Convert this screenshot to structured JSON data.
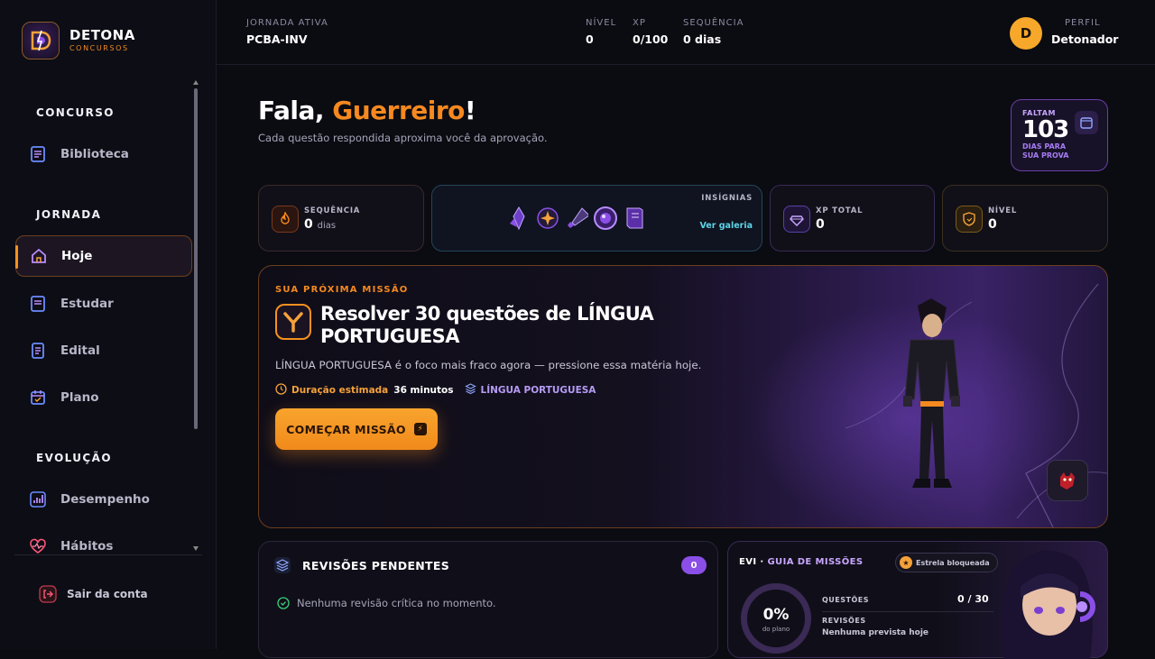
{
  "brand": {
    "name": "DETONA",
    "sub": "CONCURSOS"
  },
  "sidebar": {
    "sections": [
      "CONCURSO",
      "JORNADA",
      "EVOLUÇÃO"
    ],
    "items": [
      {
        "label": "Biblioteca",
        "icon": "book-icon",
        "active": false
      },
      {
        "label": "Hoje",
        "icon": "home-icon",
        "active": true
      },
      {
        "label": "Estudar",
        "icon": "book-icon",
        "active": false
      },
      {
        "label": "Edital",
        "icon": "document-icon",
        "active": false
      },
      {
        "label": "Plano",
        "icon": "calendar-icon",
        "active": false
      },
      {
        "label": "Desempenho",
        "icon": "bar-chart-icon",
        "active": false
      },
      {
        "label": "Hábitos",
        "icon": "heart-pulse-icon",
        "active": false
      }
    ],
    "logout": "Sair da conta"
  },
  "topbar": {
    "journey_label": "JORNADA ATIVA",
    "journey_value": "PCBA-INV",
    "level_label": "NÍVEL",
    "level_value": "0",
    "xp_label": "XP",
    "xp_value": "0/100",
    "streak_label": "SEQUÊNCIA",
    "streak_value": "0 dias",
    "avatar_letter": "D",
    "profile_label": "PERFIL",
    "profile_name": "Detonador"
  },
  "greeting": {
    "prefix": "Fala, ",
    "name": "Guerreiro",
    "suffix": "!",
    "subtitle": "Cada questão respondida aproxima você da aprovação."
  },
  "countdown": {
    "label": "FALTAM",
    "value": "103",
    "sub1": "DIAS PARA",
    "sub2": "SUA PROVA"
  },
  "stats": {
    "streak": {
      "label": "SEQUÊNCIA",
      "value": "0",
      "unit": "dias"
    },
    "badges": {
      "label": "INSÍGNIAS",
      "link": "Ver galeria"
    },
    "xp": {
      "label": "XP TOTAL",
      "value": "0"
    },
    "level": {
      "label": "NÍVEL",
      "value": "0"
    }
  },
  "mission": {
    "label": "SUA PRÓXIMA MISSÃO",
    "title": "Resolver 30 questões de LÍNGUA PORTUGUESA",
    "description": "LÍNGUA PORTUGUESA é o foco mais fraco agora — pressione essa matéria hoje.",
    "duration_label": "Duração estimada",
    "duration_value": "36 minutos",
    "subject": "LÍNGUA PORTUGUESA",
    "button": "COMEÇAR MISSÃO"
  },
  "reviews": {
    "title": "REVISÕES PENDENTES",
    "count": "0",
    "empty": "Nenhuma revisão crítica no momento."
  },
  "evi": {
    "title_prefix": "EVI · ",
    "title_accent": "GUIA DE MISSÕES",
    "star": "Estrela bloqueada",
    "progress": "0%",
    "progress_sub": "do plano",
    "questions_label": "QUESTÕES",
    "questions_value": "0 / 30",
    "reviews_label": "REVISÕES",
    "reviews_value": "Nenhuma prevista hoje"
  },
  "colors": {
    "accent": "#f5891f",
    "purple": "#8b4fe8",
    "cyan": "#5fd3e8",
    "bg": "#0b0b12"
  }
}
